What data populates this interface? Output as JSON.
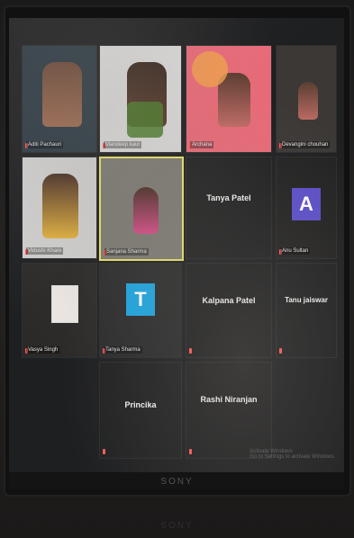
{
  "meeting": {
    "participants": [
      {
        "name": "Aditi Pachauri",
        "kind": "video"
      },
      {
        "name": "Mandeep kaur",
        "kind": "video"
      },
      {
        "name": "Archana",
        "kind": "video"
      },
      {
        "name": "Devangini chouhan",
        "kind": "video"
      },
      {
        "name": "Vidushi Khare",
        "kind": "video"
      },
      {
        "name": "Sanjana Sharma",
        "kind": "video",
        "active": true
      },
      {
        "name": "Tanya Patel",
        "kind": "name-only"
      },
      {
        "name": "Anu Sultan",
        "kind": "avatar",
        "avatar": "A",
        "avatar_color": "#5b4ec9"
      },
      {
        "name": "Vasya Singh",
        "kind": "video"
      },
      {
        "name": "Tanya Sharma",
        "kind": "avatar",
        "avatar": "T",
        "avatar_color": "#1aa6e2"
      },
      {
        "name": "Kalpana Patel",
        "kind": "name-only"
      },
      {
        "name": "Tanu jaiswar",
        "kind": "name-only"
      },
      {
        "name": "Princika",
        "kind": "name-only"
      },
      {
        "name": "Rashi Niranjan",
        "kind": "name-only"
      }
    ]
  },
  "overlay": {
    "activate_line1": "Activate Windows",
    "activate_line2": "Go to Settings to activate Windows."
  },
  "brand": {
    "monitor": "SONY",
    "reflection": "SONY"
  },
  "colors": {
    "active_border": "#e8e26a",
    "tile_bg": "#232426"
  }
}
